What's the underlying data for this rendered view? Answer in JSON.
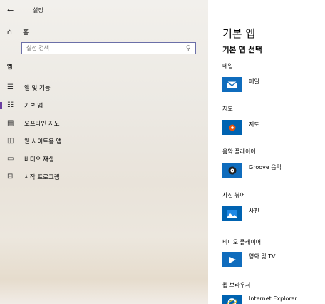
{
  "window": {
    "back_glyph": "←",
    "title": "설정"
  },
  "home": {
    "label": "홈",
    "icon": "home-icon"
  },
  "search": {
    "placeholder": "설정 검색",
    "icon": "search-icon"
  },
  "sidebar": {
    "section": "앱",
    "items": [
      {
        "label": "앱 및 기능",
        "icon": "apps-features-icon"
      },
      {
        "label": "기본 앱",
        "icon": "default-apps-icon",
        "selected": true
      },
      {
        "label": "오프라인 지도",
        "icon": "offline-maps-icon"
      },
      {
        "label": "웹 사이트용 앱",
        "icon": "apps-for-websites-icon"
      },
      {
        "label": "비디오 재생",
        "icon": "video-playback-icon"
      },
      {
        "label": "시작 프로그램",
        "icon": "startup-icon"
      }
    ]
  },
  "main": {
    "title": "기본 앱",
    "subtitle": "기본 앱 선택",
    "groups": [
      {
        "label": "메일",
        "app": "메일",
        "icon": "mail-icon",
        "color": "#0f6cbd"
      },
      {
        "label": "지도",
        "app": "지도",
        "icon": "maps-icon",
        "color": "#0063b1"
      },
      {
        "label": "음악 플레이어",
        "app": "Groove 음악",
        "icon": "groove-music-icon",
        "color": "#0f6cbd"
      },
      {
        "label": "사진 뷰어",
        "app": "사진",
        "icon": "photos-icon",
        "color": "#0063b1"
      },
      {
        "label": "비디오 플레이어",
        "app": "영화 및 TV",
        "icon": "movies-tv-icon",
        "color": "#0f6cbd"
      },
      {
        "label": "웹 브라우저",
        "app": "Internet Explorer",
        "icon": "internet-explorer-icon",
        "color": "#0063b1"
      }
    ]
  },
  "colors": {
    "accent": "#6b3fa0",
    "tile": "#0f6cbd",
    "search_border": "#6b6fa8"
  }
}
